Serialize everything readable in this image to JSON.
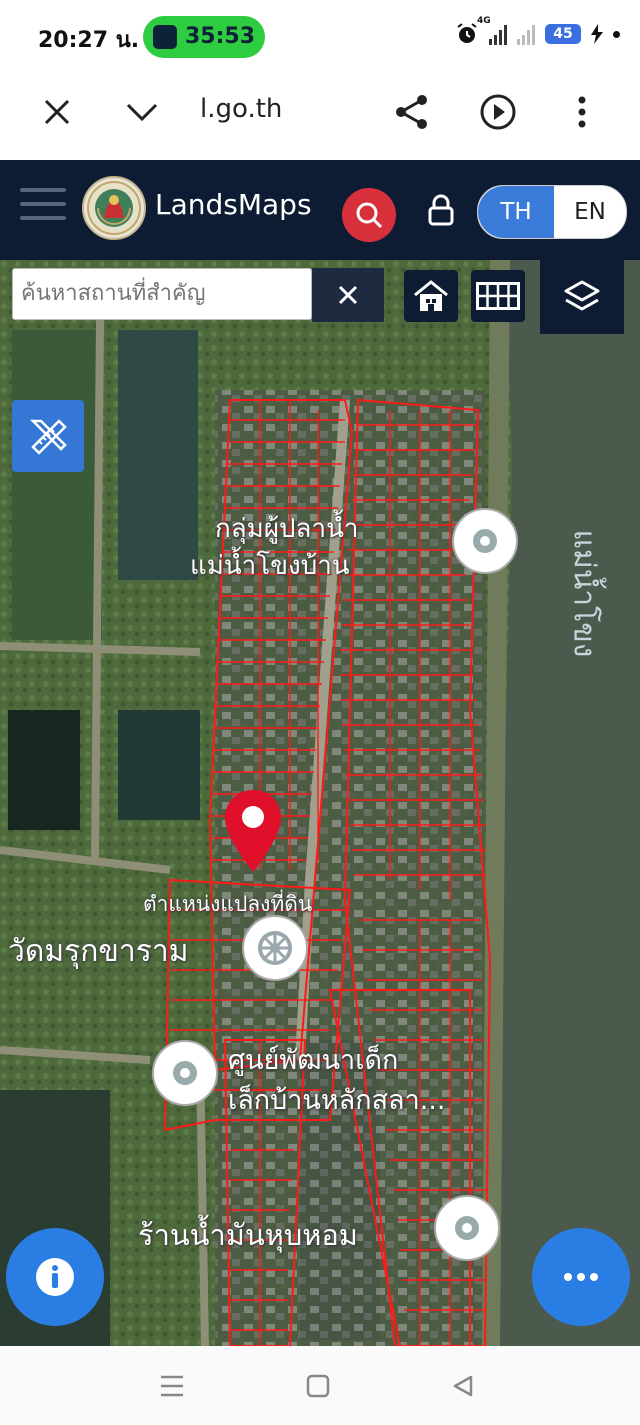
{
  "status_bar": {
    "time": "20:27 น.",
    "call_timer": "35:53",
    "network_tag": "4G",
    "battery": "45"
  },
  "browser": {
    "url": "l.go.th"
  },
  "app": {
    "brand": "LandsMaps",
    "lang_th": "TH",
    "lang_en": "EN",
    "active_lang": "TH"
  },
  "map": {
    "search_placeholder": "ค้นหาสถานที่สำคัญ",
    "labels": {
      "area_line1": "กลุ่มผู้ปลาน้ำ",
      "area_line2": "แม่น้ำโขงบ้าน",
      "river": "แม่น้ำโขง",
      "parcel": "ตำแหน่งแปลงที่ดิน",
      "temple": "วัดมรุกขาราม",
      "child_center_line1": "ศูนย์พัฒนาเด็ก",
      "child_center_line2": "เล็กบ้านหลักสลา...",
      "shop": "ร้านน้ำมันหุบหอม"
    },
    "colors": {
      "parcel_lines": "#ff1a1a",
      "marker": "#e0102a",
      "river": "#4b5a4c",
      "fab": "#2a7ee3"
    }
  }
}
